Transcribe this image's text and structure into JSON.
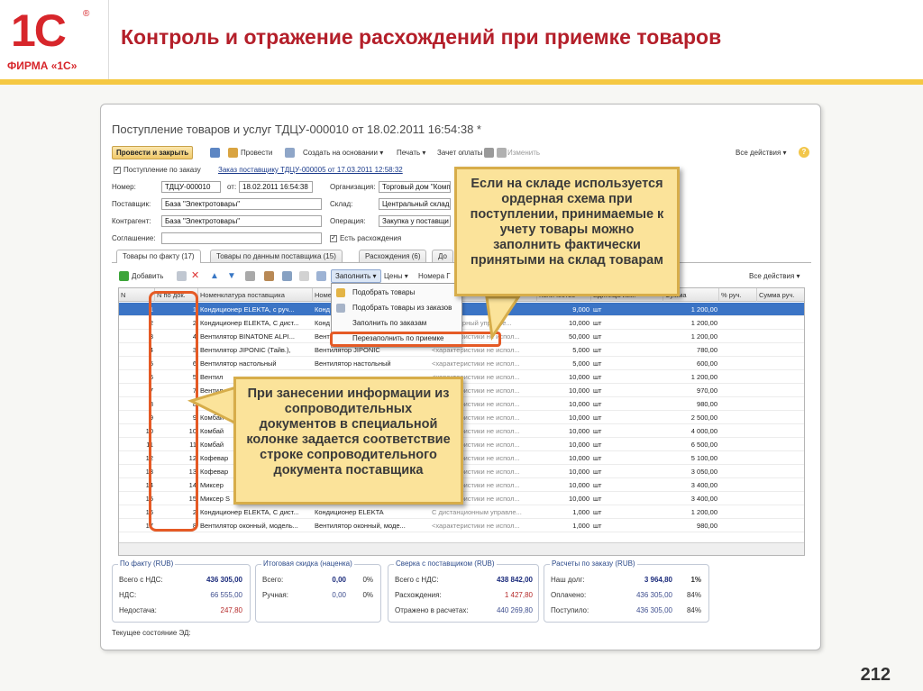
{
  "slide": {
    "title": "Контроль и отражение расхождений при приемке товаров",
    "page_number": "212",
    "logo_mark": "1С",
    "logo_reg": "®",
    "logo_firm": "ФИРМА «1С»"
  },
  "doc": {
    "title": "Поступление товаров и услуг ТДЦУ-000010 от 18.02.2011 16:54:38 *"
  },
  "toolbar": {
    "post_close": "Провести и закрыть",
    "post": "Провести",
    "create_based": "Создать на основании ▾",
    "print": "Печать ▾",
    "payment_offset": "Зачет оплаты",
    "change": "Изменить",
    "all_actions": "Все действия ▾",
    "help": "?"
  },
  "form": {
    "by_order_label": "Поступление по заказу",
    "order_link": "Заказ поставщику ТДЦУ-000005 от 17.03.2011 12:58:32",
    "number_label": "Номер:",
    "number": "ТДЦУ-000010",
    "date_label": "от:",
    "date": "18.02.2011 16:54:38",
    "org_label": "Организация:",
    "org": "Торговый дом \"Комп",
    "supplier_label": "Поставщик:",
    "supplier": "База \"Электротовары\"",
    "warehouse_label": "Склад:",
    "warehouse": "Центральный склад",
    "counterparty_label": "Контрагент:",
    "counterparty": "База \"Электротовары\"",
    "operation_label": "Операция:",
    "operation": "Закупка у поставщи",
    "agreement_label": "Соглашение:",
    "agreement": "",
    "discrepancy_label": "Есть расхождения"
  },
  "tabs": [
    {
      "label": "Товары по факту (17)"
    },
    {
      "label": "Товары по данным поставщика (15)"
    },
    {
      "label": "Расхождения (6)"
    },
    {
      "label": "До"
    }
  ],
  "tabbar": {
    "add": "Добавить",
    "fill": "Заполнить ▾",
    "prices": "Цены ▾",
    "numbers": "Номера Г",
    "all_actions": "Все действия ▾"
  },
  "menu": {
    "items": [
      {
        "label": "Подобрать товары"
      },
      {
        "label": "Подобрать товары из заказов"
      },
      {
        "label": "Заполнить по заказам"
      },
      {
        "label": "Перезаполнить по приемке"
      }
    ]
  },
  "grid": {
    "headers": [
      "N",
      "N по док.",
      "Номенклатура поставщика",
      "Номе",
      "",
      "",
      "Количество",
      "Единица изм.",
      "Сумма",
      "% руч.",
      "Сумма руч."
    ],
    "rows": [
      [
        "1",
        "1",
        "Кондиционер ELEKTA, с руч...",
        "Конд",
        "",
        "",
        "9,000",
        "шт",
        "1 200,00"
      ],
      [
        "2",
        "2",
        "Кондиционер ELEKTA, С дист...",
        "Конд",
        "",
        "Стационарный управле...",
        "10,000",
        "шт",
        "1 200,00"
      ],
      [
        "3",
        "4",
        "Вентилятор BINATONE ALPI...",
        "Вент",
        "",
        "<характеристики не испол...",
        "50,000",
        "шт",
        "1 200,00"
      ],
      [
        "4",
        "3",
        "Вентилятор JIPONIC (Тайв.),",
        "Вентилятор JIPONIC",
        "",
        "<характеристики не испол...",
        "5,000",
        "шт",
        "780,00"
      ],
      [
        "5",
        "6",
        "Вентилятор настольный",
        "Вентилятор настольный",
        "",
        "<характеристики не испол...",
        "5,000",
        "шт",
        "600,00"
      ],
      [
        "6",
        "5",
        "Вентил",
        "",
        "",
        "<характеристики не испол...",
        "10,000",
        "шт",
        "1 200,00"
      ],
      [
        "7",
        "7",
        "Вентил",
        "",
        "",
        "<характеристики не испол...",
        "10,000",
        "шт",
        "970,00"
      ],
      [
        "8",
        "8",
        "Вентил",
        "",
        "",
        "<характеристики не испол...",
        "10,000",
        "шт",
        "980,00"
      ],
      [
        "9",
        "9",
        "Комбай",
        "",
        "",
        "<характеристики не испол...",
        "10,000",
        "шт",
        "2 500,00"
      ],
      [
        "10",
        "10",
        "Комбай",
        "",
        "",
        "<характеристики не испол...",
        "10,000",
        "шт",
        "4 000,00"
      ],
      [
        "11",
        "11",
        "Комбай",
        "",
        "",
        "<характеристики не испол...",
        "10,000",
        "шт",
        "6 500,00"
      ],
      [
        "12",
        "12",
        "Кофевар",
        "",
        "",
        "<характеристики не испол...",
        "10,000",
        "шт",
        "5 100,00"
      ],
      [
        "13",
        "13",
        "Кофевар",
        "",
        "",
        "<характеристики не испол...",
        "10,000",
        "шт",
        "3 050,00"
      ],
      [
        "14",
        "14",
        "Миксер",
        "",
        "",
        "<характеристики не испол...",
        "10,000",
        "шт",
        "3 400,00"
      ],
      [
        "15",
        "15",
        "Миксер S",
        "",
        "",
        "<характеристики не испол...",
        "10,000",
        "шт",
        "3 400,00"
      ],
      [
        "16",
        "2",
        "Кондиционер ELEKTA, С дист...",
        "Кондиционер ELEKTA",
        "",
        "С дистанционным управле...",
        "1,000",
        "шт",
        "1 200,00"
      ],
      [
        "17",
        "8",
        "Вентилятор оконный, модель...",
        "Вентилятор оконный, моде...",
        "",
        "<характеристики не испол...",
        "1,000",
        "шт",
        "980,00"
      ]
    ]
  },
  "footer": {
    "fact": {
      "title": "По факту (RUB)",
      "total_label": "Всего с НДС:",
      "total": "436 305,00",
      "vat_label": "НДС:",
      "vat": "66 555,00",
      "shortage_label": "Недостача:",
      "shortage": "247,80"
    },
    "discount": {
      "title": "Итоговая скидка (наценка)",
      "total_label": "Всего:",
      "total": "0,00",
      "total_pct": "0%",
      "manual_label": "Ручная:",
      "manual": "0,00",
      "manual_pct": "0%"
    },
    "reconcile": {
      "title": "Сверка с поставщиком (RUB)",
      "total_label": "Всего с НДС:",
      "total": "438 842,00",
      "diff_label": "Расхождения:",
      "diff": "1 427,80",
      "reflected_label": "Отражено в расчетах:",
      "reflected": "440 269,80"
    },
    "settlements": {
      "title": "Расчеты по заказу (RUB)",
      "debt_label": "Наш долг:",
      "debt": "3 964,80",
      "debt_pct": "1%",
      "paid_label": "Оплачено:",
      "paid": "436 305,00",
      "paid_pct": "84%",
      "received_label": "Поступило:",
      "received": "436 305,00",
      "received_pct": "84%"
    },
    "status": "Текущее состояние ЭД:"
  },
  "callouts": {
    "top": "Если на складе используется ордерная схема при поступлении, принимаемые к учету товары можно заполнить фактически принятыми на склад товарам",
    "left": "При занесении информации из сопроводительных документов в специальной колонке задается соответствие строке сопроводительного документа поставщика"
  },
  "colors": {
    "title": "#b41f2a",
    "accent_bar": "#f5c842",
    "callout_bg": "#fbe39a",
    "highlight": "#e55a25",
    "selected_row": "#3b74c5"
  }
}
